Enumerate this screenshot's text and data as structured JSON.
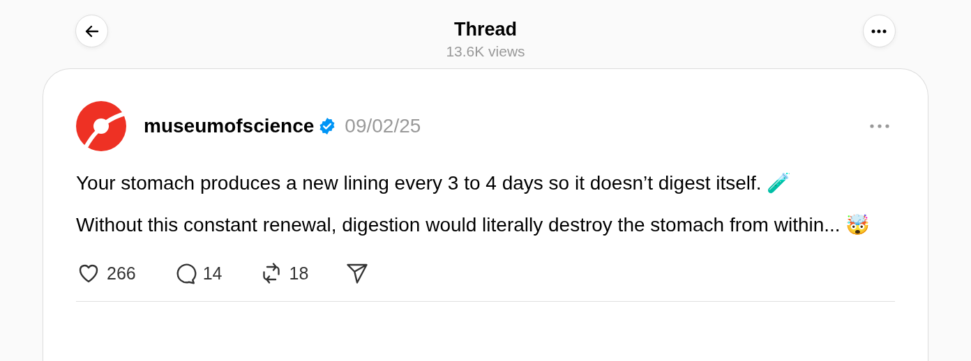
{
  "header": {
    "title": "Thread",
    "views": "13.6K views"
  },
  "post": {
    "author": "museumofscience",
    "verified": true,
    "date": "09/02/25",
    "paragraphs": [
      "Your stomach produces a new lining every 3 to 4 days so it doesn’t digest itself. 🧪",
      "Without this constant renewal, digestion would literally destroy the stomach from within... 🤯"
    ],
    "actions": [
      {
        "kind": "like",
        "count": "266"
      },
      {
        "kind": "reply",
        "count": "14"
      },
      {
        "kind": "repost",
        "count": "18"
      },
      {
        "kind": "share"
      }
    ]
  }
}
